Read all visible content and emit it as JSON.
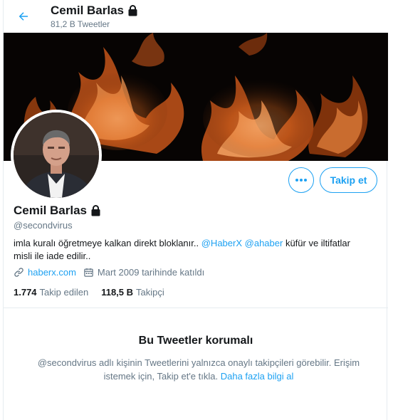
{
  "header": {
    "name": "Cemil Barlas",
    "tweet_count": "81,2 B Tweetler"
  },
  "profile": {
    "name": "Cemil Barlas",
    "handle": "@secondvirus",
    "bio": {
      "text_before": "imla kuralı öğretmeye kalkan direkt bloklanır.. ",
      "mention1": "@HaberX",
      "mention2": "@ahaber",
      "text_after": " küfür ve iltifatlar misli ile iade edilir.."
    },
    "website": "haberx.com",
    "joined": "Mart 2009 tarihinde katıldı",
    "following_count": "1.774",
    "following_label": "Takip edilen",
    "followers_count": "118,5 B",
    "followers_label": "Takipçi"
  },
  "actions": {
    "more_icon": "more-dots-icon",
    "follow_label": "Takip et"
  },
  "protected": {
    "title": "Bu Tweetler korumalı",
    "message": "@secondvirus adlı kişinin Tweetlerini yalnızca onaylı takipçileri görebilir. Erişim istemek için, Takip et'e tıkla.",
    "learn_more": "Daha fazla bilgi al"
  },
  "colors": {
    "accent": "#1da1f2",
    "text": "#14171a",
    "muted": "#657786"
  }
}
